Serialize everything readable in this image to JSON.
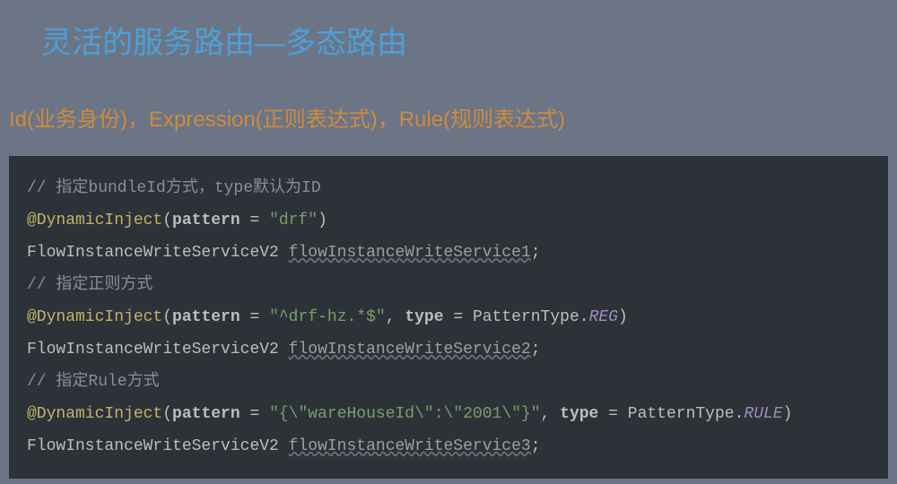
{
  "title": "灵活的服务路由—多态路由",
  "subtitle": "Id(业务身份)，Expression(正则表达式)，Rule(规则表达式)",
  "code": {
    "comment1": "// 指定bundleId方式，type默认为ID",
    "anno": "@DynamicInject",
    "lp": "(",
    "rp": ")",
    "pattern_kw": "pattern",
    "eq": " = ",
    "type_kw": "type",
    "patternType": "PatternType",
    "dot": ".",
    "semi": ";",
    "comma": ", ",
    "className": "FlowInstanceWriteServiceV2",
    "pattern1": "\"drf\"",
    "var1": "flowInstanceWriteService1",
    "comment2": "// 指定正则方式",
    "pattern2": "\"^drf-hz.*$\"",
    "reg": "REG",
    "var2": "flowInstanceWriteService2",
    "comment3": "// 指定Rule方式",
    "pattern3": "\"{\\\"wareHouseId\\\":\\\"2001\\\"}\"",
    "rule": "RULE",
    "var3": "flowInstanceWriteService3"
  }
}
